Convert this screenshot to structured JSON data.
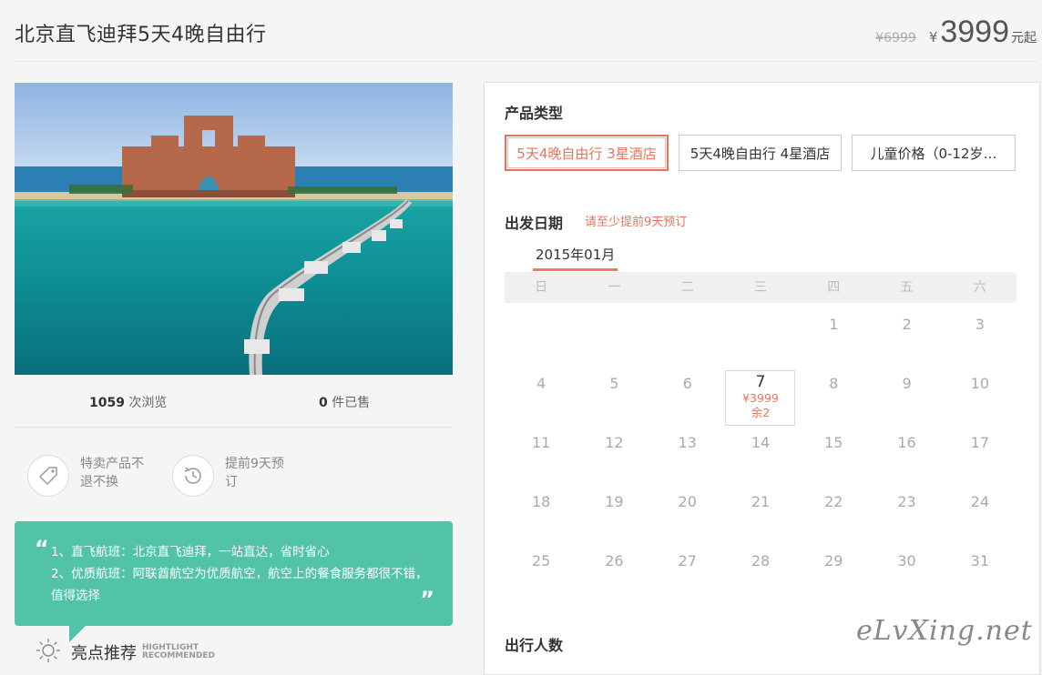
{
  "product": {
    "title": "北京直飞迪拜5天4晚自由行",
    "old_price": "¥6999",
    "currency": "¥",
    "price": "3999",
    "price_unit": "元起"
  },
  "stats": {
    "views_count": "1059",
    "views_label": "次浏览",
    "sold_count": "0",
    "sold_label": "件已售"
  },
  "features": [
    {
      "icon": "tag-icon",
      "text": "特卖产品不退不换"
    },
    {
      "icon": "clock-icon",
      "text": "提前9天预订"
    }
  ],
  "highlights": {
    "open_quote": "“",
    "close_quote": "”",
    "line1": "1、直飞航班：北京直飞迪拜，一站直达，省时省心",
    "line2": "2、优质航班：阿联酋航空为优质航空，航空上的餐食服务都很不错，值得选择",
    "title": "亮点推荐",
    "subtitle_line1": "HIGHTLIGHT",
    "subtitle_line2": "RECOMMENDED"
  },
  "booking": {
    "type_section": "产品类型",
    "types": [
      "5天4晚自由行 3星酒店",
      "5天4晚自由行 4星酒店",
      "儿童价格（0-12岁…"
    ],
    "selected_type": 0,
    "date_section": "出发日期",
    "notice": "请至少提前9天预订",
    "month": "2015年01月",
    "weekdays": [
      "日",
      "一",
      "二",
      "三",
      "四",
      "五",
      "六"
    ],
    "first_weekday": 4,
    "days_in_month": 31,
    "available": {
      "day": "7",
      "price": "¥3999",
      "remaining": "余2"
    },
    "travelers_section": "出行人数"
  },
  "watermark": "eLvXing.net",
  "colors": {
    "accent": "#e8735c",
    "teal": "#52c3a8"
  }
}
